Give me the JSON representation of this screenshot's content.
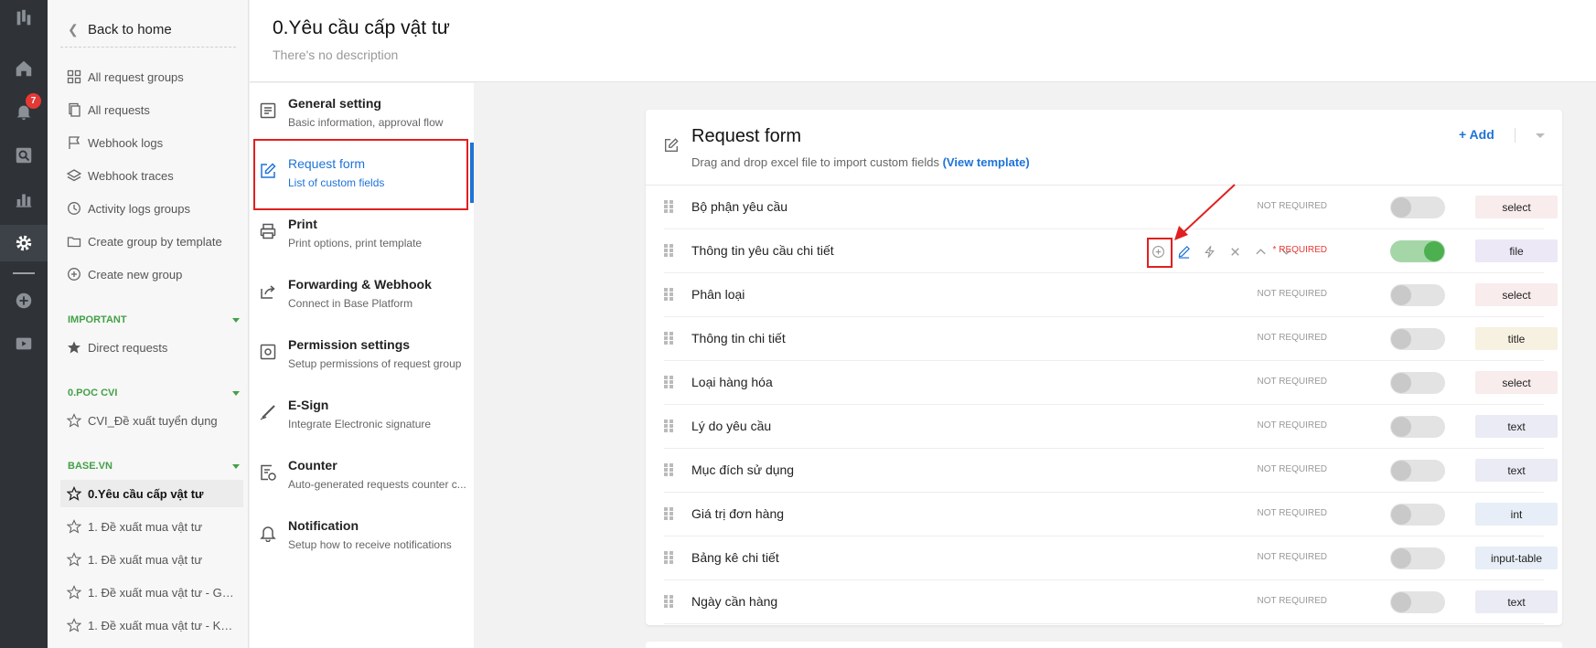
{
  "rail": {
    "notification_count": "7",
    "icons": [
      "logo-icon",
      "home-icon",
      "bell-icon",
      "search-icon",
      "chart-icon",
      "gear-icon",
      "plus-circle-icon",
      "play-icon"
    ]
  },
  "nav": {
    "back_label": "Back to home",
    "items": [
      {
        "label": "All request groups",
        "icon": "grid-icon"
      },
      {
        "label": "All requests",
        "icon": "copy-icon"
      },
      {
        "label": "Webhook logs",
        "icon": "flag-icon"
      },
      {
        "label": "Webhook traces",
        "icon": "layers-icon"
      },
      {
        "label": "Activity logs groups",
        "icon": "clock-icon"
      },
      {
        "label": "Create group by template",
        "icon": "folder-icon"
      },
      {
        "label": "Create new group",
        "icon": "plus-circle-icon"
      }
    ],
    "sections": [
      {
        "title": "IMPORTANT",
        "items": [
          {
            "label": "Direct requests",
            "icon": "star-filled-icon"
          }
        ]
      },
      {
        "title": "0.POC CVI",
        "items": [
          {
            "label": "CVI_Đề xuất tuyển dụng",
            "icon": "star-icon"
          }
        ]
      },
      {
        "title": "BASE.VN",
        "items": [
          {
            "label": "0.Yêu cầu cấp vật tư",
            "icon": "star-icon",
            "current": true
          },
          {
            "label": "1. Đề xuất mua vật tư",
            "icon": "star-icon"
          },
          {
            "label": "1. Đề xuất mua vật tư",
            "icon": "star-icon"
          },
          {
            "label": "1. Đề xuất mua vật tư - Gi...",
            "icon": "star-icon"
          },
          {
            "label": "1. Đề xuất mua vật tư - Kế...",
            "icon": "star-icon"
          }
        ]
      }
    ]
  },
  "header": {
    "title": "0.Yêu cầu cấp vật tư",
    "description": "There's no description"
  },
  "settings_menu": [
    {
      "title": "General setting",
      "subtitle": "Basic information, approval flow",
      "icon": "document-icon"
    },
    {
      "title": "Request form",
      "subtitle": "List of custom fields",
      "icon": "edit-icon",
      "active": true
    },
    {
      "title": "Print",
      "subtitle": "Print options, print template",
      "icon": "printer-icon"
    },
    {
      "title": "Forwarding & Webhook",
      "subtitle": "Connect in Base Platform",
      "icon": "share-icon"
    },
    {
      "title": "Permission settings",
      "subtitle": "Setup permissions of request group",
      "icon": "lock-icon"
    },
    {
      "title": "E-Sign",
      "subtitle": "Integrate Electronic signature",
      "icon": "pen-icon"
    },
    {
      "title": "Counter",
      "subtitle": "Auto-generated requests counter c...",
      "icon": "counter-icon"
    },
    {
      "title": "Notification",
      "subtitle": "Setup how to receive notifications",
      "icon": "bell-icon"
    }
  ],
  "request_form": {
    "title": "Request form",
    "subtitle": "Drag and drop excel file to import custom fields",
    "template_link": "(View template)",
    "add_label": "+ Add",
    "fields": [
      {
        "name": "Bộ phận yêu cầu",
        "required_label": "NOT REQUIRED",
        "required": false,
        "type": "select",
        "type_color": "#f8ecec"
      },
      {
        "name": "Thông tin yêu cầu chi tiết",
        "required_label": "* REQUIRED",
        "required": true,
        "type": "file",
        "type_color": "#ece8f5",
        "hover": true
      },
      {
        "name": "Phân loại",
        "required_label": "NOT REQUIRED",
        "required": false,
        "type": "select",
        "type_color": "#f8ecec"
      },
      {
        "name": "Thông tin chi tiết",
        "required_label": "NOT REQUIRED",
        "required": false,
        "type": "title",
        "type_color": "#f7f1e1"
      },
      {
        "name": "Loại hàng hóa",
        "required_label": "NOT REQUIRED",
        "required": false,
        "type": "select",
        "type_color": "#f8ecec"
      },
      {
        "name": "Lý do yêu cầu",
        "required_label": "NOT REQUIRED",
        "required": false,
        "type": "text",
        "type_color": "#ebebf5"
      },
      {
        "name": "Mục đích sử dụng",
        "required_label": "NOT REQUIRED",
        "required": false,
        "type": "text",
        "type_color": "#ebebf5"
      },
      {
        "name": "Giá trị đơn hàng",
        "required_label": "NOT REQUIRED",
        "required": false,
        "type": "int",
        "type_color": "#e7eef7"
      },
      {
        "name": "Bảng kê chi tiết",
        "required_label": "NOT REQUIRED",
        "required": false,
        "type": "input-table",
        "type_color": "#e7eef7"
      },
      {
        "name": "Ngày cần hàng",
        "required_label": "NOT REQUIRED",
        "required": false,
        "type": "text",
        "type_color": "#ebebf5"
      }
    ],
    "row_actions": [
      "plus-circle-icon",
      "edit-icon",
      "bolt-icon",
      "close-icon",
      "chevron-up-icon",
      "chevron-down-icon"
    ]
  },
  "colors": {
    "accent": "#1e73d8",
    "highlight": "#e02020",
    "section": "#43a047",
    "toggle_on": "#4caf50"
  }
}
